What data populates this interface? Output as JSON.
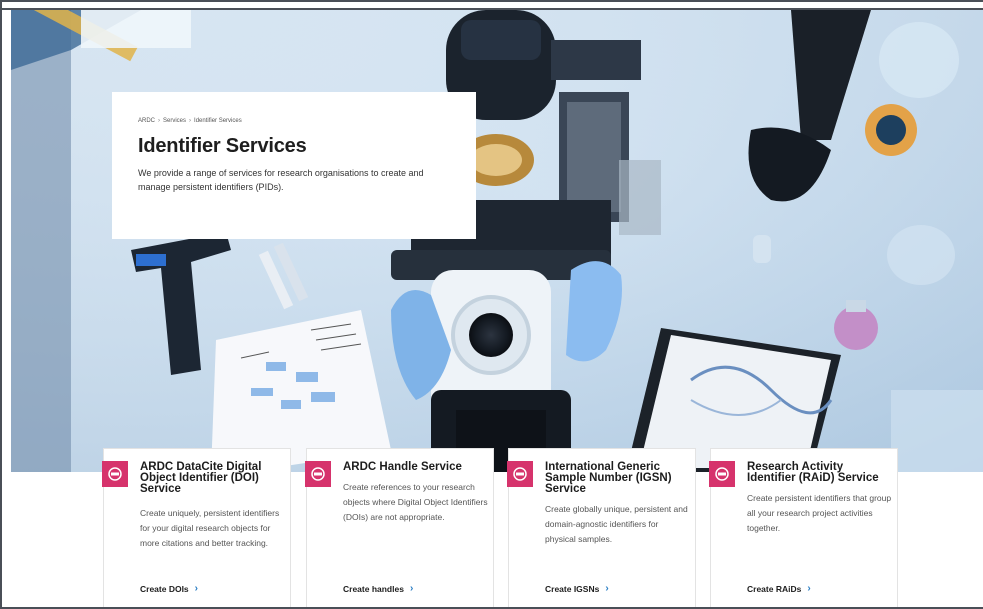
{
  "hero": {
    "breadcrumb": [
      "ARDC",
      "Services",
      "Identifier Services"
    ],
    "breadcrumb_sep": "›",
    "title": "Identifier Services",
    "description": "We provide a range of services for research organisations to create and manage persistent identifiers (PIDs)."
  },
  "colors": {
    "accent": "#d6336c",
    "link_chevron": "#2a7ec4",
    "frame": "#4a4f57"
  },
  "cards": [
    {
      "icon": "identifier-badge-icon",
      "title": "ARDC DataCite Digital Object Identifier (DOI) Service",
      "description": "Create uniquely, persistent identifiers for your digital research objects for more citations and better tracking.",
      "link_label": "Create DOIs",
      "link_chevron": "›"
    },
    {
      "icon": "identifier-badge-icon",
      "title": "ARDC Handle Service",
      "description": "Create references to your research objects where Digital Object Identifiers (DOIs) are not appropriate.",
      "link_label": "Create handles",
      "link_chevron": "›"
    },
    {
      "icon": "identifier-badge-icon",
      "title": "International Generic Sample Number (IGSN) Service",
      "description": "Create globally unique, persistent and domain-agnostic identifiers for physical samples.",
      "link_label": "Create IGSNs",
      "link_chevron": "›"
    },
    {
      "icon": "identifier-badge-icon",
      "title": "Research Activity Identifier (RAiD) Service",
      "description": "Create persistent identifiers that group all your research project activities together.",
      "link_label": "Create RAiDs",
      "link_chevron": "›"
    }
  ]
}
